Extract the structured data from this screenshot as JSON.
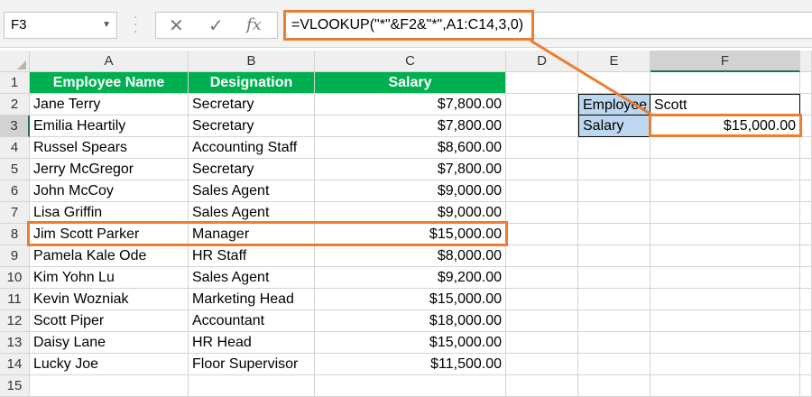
{
  "formula_bar": {
    "name_box": "F3",
    "cancel_icon": "✕",
    "enter_icon": "✓",
    "fx_label": "fx",
    "formula": "=VLOOKUP(\"*\"&F2&\"*\",A1:C14,3,0)"
  },
  "columns": [
    "A",
    "B",
    "C",
    "D",
    "E",
    "F"
  ],
  "rows": [
    "1",
    "2",
    "3",
    "4",
    "5",
    "6",
    "7",
    "8",
    "9",
    "10",
    "11",
    "12",
    "13",
    "14",
    "15"
  ],
  "table": {
    "headers": [
      "Employee Name",
      "Designation",
      "Salary"
    ],
    "data": [
      [
        "Jane Terry",
        "Secretary",
        "$7,800.00"
      ],
      [
        "Emilia Heartily",
        "Secretary",
        "$7,800.00"
      ],
      [
        "Russel Spears",
        "Accounting Staff",
        "$8,600.00"
      ],
      [
        "Jerry McGregor",
        "Secretary",
        "$7,800.00"
      ],
      [
        "John McCoy",
        "Sales Agent",
        "$9,000.00"
      ],
      [
        "Lisa Griffin",
        "Sales Agent",
        "$9,000.00"
      ],
      [
        "Jim Scott Parker",
        "Manager",
        "$15,000.00"
      ],
      [
        "Pamela Kale Ode",
        "HR Staff",
        "$8,000.00"
      ],
      [
        "Kim Yohn Lu",
        "Sales Agent",
        "$9,200.00"
      ],
      [
        "Kevin Wozniak",
        "Marketing Head",
        "$15,000.00"
      ],
      [
        "Scott Piper",
        "Accountant",
        "$18,000.00"
      ],
      [
        "Daisy Lane",
        "HR Head",
        "$15,000.00"
      ],
      [
        "Lucky Joe",
        "Floor Supervisor",
        "$11,500.00"
      ]
    ]
  },
  "lookup": {
    "employee_label": "Employee",
    "employee_value": "Scott",
    "salary_label": "Salary",
    "salary_value": "$15,000.00"
  },
  "colors": {
    "header_green": "#00b050",
    "highlight_orange": "#ed7d31",
    "label_blue": "#bdd7ee"
  }
}
